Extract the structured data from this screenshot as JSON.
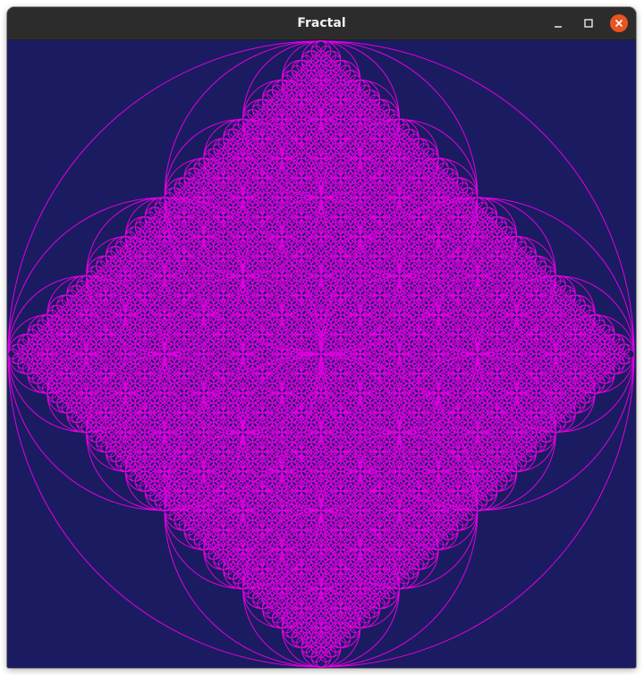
{
  "window": {
    "title": "Fractal",
    "buttons": [
      {
        "name": "minimize",
        "icon": "minimize-icon"
      },
      {
        "name": "maximize",
        "icon": "maximize-icon"
      },
      {
        "name": "close",
        "icon": "close-icon"
      }
    ]
  },
  "colors": {
    "background": "#1b1b61",
    "stroke": "#e000e0",
    "titlebar": "#2c2c2c",
    "close_button": "#e95420"
  }
}
